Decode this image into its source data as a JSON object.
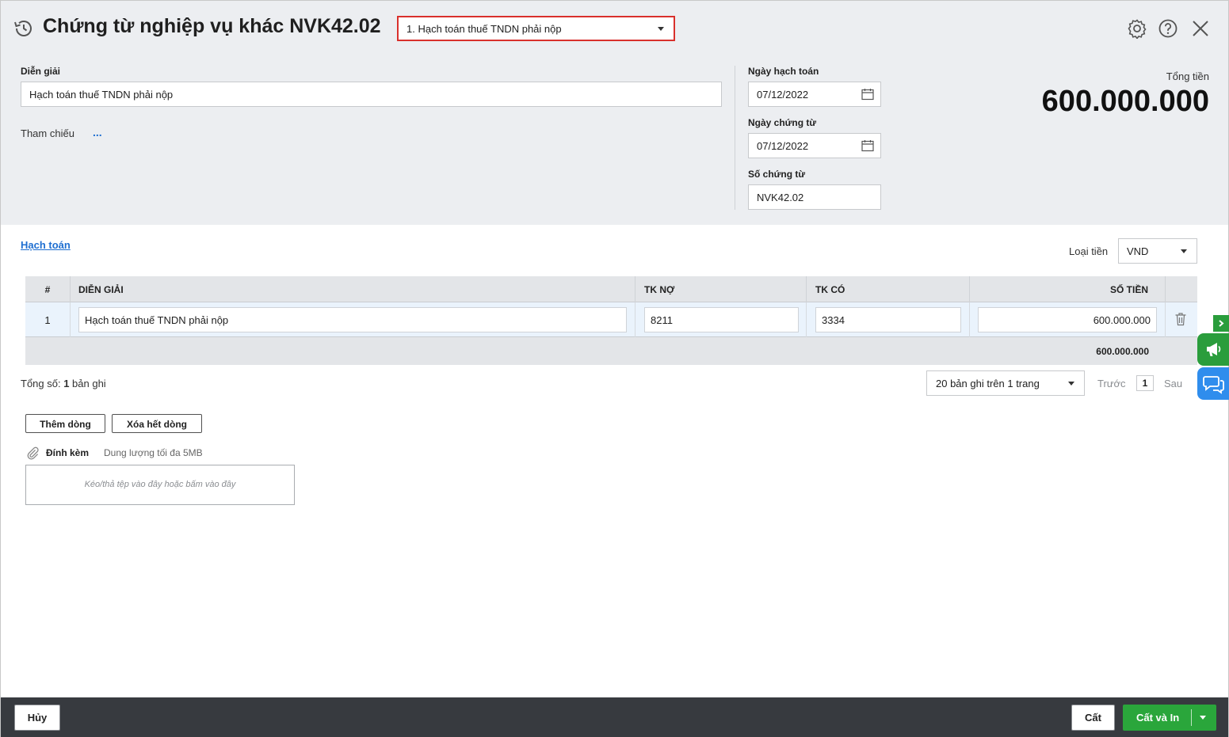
{
  "header": {
    "title": "Chứng từ nghiệp vụ khác NVK42.02",
    "type_selected": "1. Hạch toán thuế TNDN phải nộp",
    "icons": [
      "history-icon",
      "gear-icon",
      "help-icon",
      "close-icon"
    ]
  },
  "form": {
    "description_label": "Diễn giải",
    "description_value": "Hạch toán thuế TNDN phải nộp",
    "reference_label": "Tham chiếu",
    "reference_link": "...",
    "posting_date_label": "Ngày hạch toán",
    "posting_date_value": "07/12/2022",
    "voucher_date_label": "Ngày chứng từ",
    "voucher_date_value": "07/12/2022",
    "voucher_no_label": "Số chứng từ",
    "voucher_no_value": "NVK42.02",
    "total_label": "Tổng tiền",
    "total_value": "600.000.000"
  },
  "detail": {
    "tab_label": "Hạch toán",
    "currency_label": "Loại tiền",
    "currency_value": "VND",
    "columns": {
      "no": "#",
      "description": "DIỄN GIẢI",
      "debit": "TK NỢ",
      "credit": "TK CÓ",
      "amount": "SỐ TIỀN"
    },
    "rows": [
      {
        "no": "1",
        "description": "Hạch toán thuế TNDN phải nộp",
        "debit": "8211",
        "credit": "3334",
        "amount": "600.000.000"
      }
    ],
    "footer_total": "600.000.000"
  },
  "pagination": {
    "total_prefix": "Tổng số: ",
    "total_count": "1",
    "total_suffix": " bản ghi",
    "page_size": "20 bản ghi trên 1 trang",
    "prev": "Trước",
    "page": "1",
    "next": "Sau"
  },
  "actions": {
    "add_row": "Thêm dòng",
    "delete_all_rows": "Xóa hết dòng"
  },
  "attachment": {
    "label": "Đính kèm",
    "hint": "Dung lượng tối đa 5MB",
    "dropzone": "Kéo/thả tệp vào đây hoặc bấm vào đây"
  },
  "footer": {
    "cancel": "Hủy",
    "save": "Cất",
    "save_print": "Cất và In"
  },
  "colors": {
    "highlight_border": "#d9302c",
    "link": "#1f6fd1",
    "primary_green": "#2aa63b",
    "chat_blue": "#2f8ded",
    "footer_bg": "#373a3f"
  }
}
